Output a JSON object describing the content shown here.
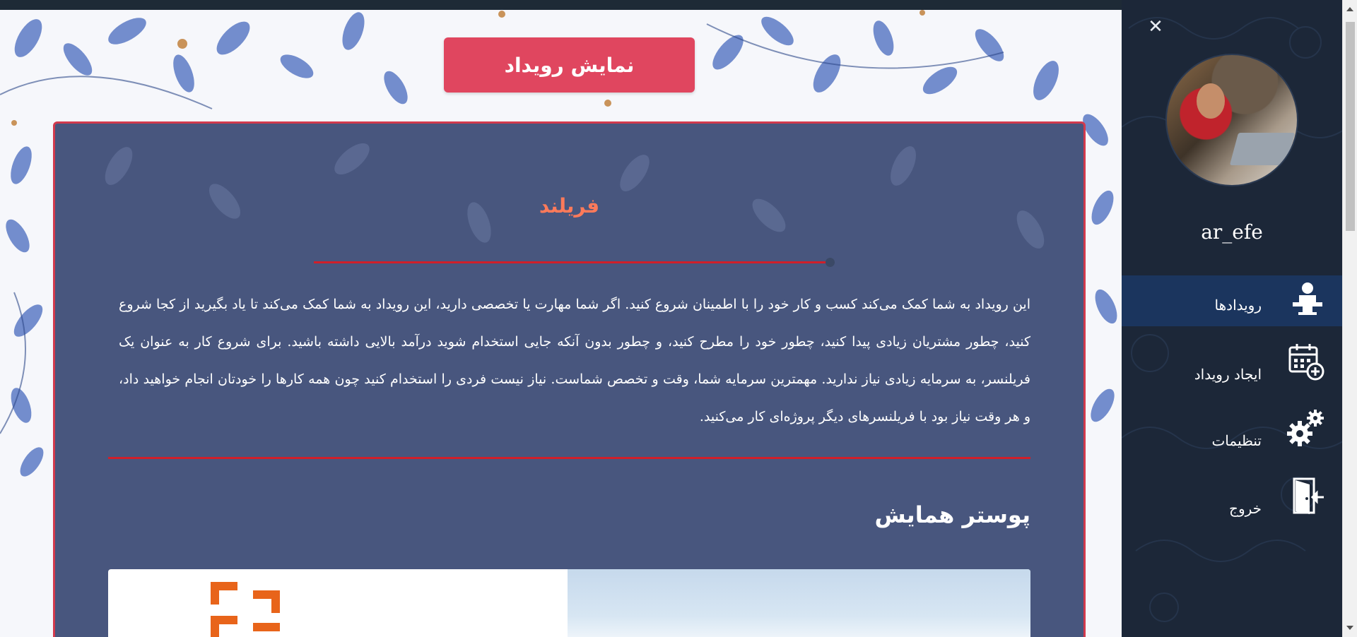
{
  "header": {
    "title": "نمایش رویداد"
  },
  "event": {
    "title": "فریلند",
    "description": "این رویداد به شما کمک می‌کند کسب و کار خود را با اطمینان شروع کنید. اگر شما مهارت یا تخصصی دارید، این رویداد به شما کمک می‌کند تا یاد بگیرید از کجا شروع کنید، چطور مشتریان زیادی پیدا کنید، چطور خود را مطرح کنید، و چطور بدون آنکه جایی استخدام شوید درآمد بالایی داشته باشید. برای شروع کار به عنوان یک فریلنسر، به سرمایه زیادی نیاز ندارید. مهمترین سرمایه شما، وقت و تخصص شماست. نیاز نیست فردی را استخدام کنید چون همه کارها را خودتان انجام خواهید داد، و هر وقت نیاز بود با فریلنسرهای دیگر پروژه‌ای کار می‌کنید.",
    "poster_title": "پوستر همایش"
  },
  "sidebar": {
    "username": "ar_efe",
    "items": [
      {
        "label": "رویدادها",
        "icon": "events-icon",
        "active": true
      },
      {
        "label": "ایجاد رویداد",
        "icon": "calendar-add-icon",
        "active": false
      },
      {
        "label": "تنظیمات",
        "icon": "gears-icon",
        "active": false
      },
      {
        "label": "خروج",
        "icon": "logout-door-icon",
        "active": false
      }
    ]
  },
  "colors": {
    "accent": "#e0465f",
    "panel": "#30406c",
    "event_title": "#ff7a5a",
    "divider": "#d01f2a",
    "sidebar": "#1c2738",
    "sidebar_active": "#1b355e"
  }
}
